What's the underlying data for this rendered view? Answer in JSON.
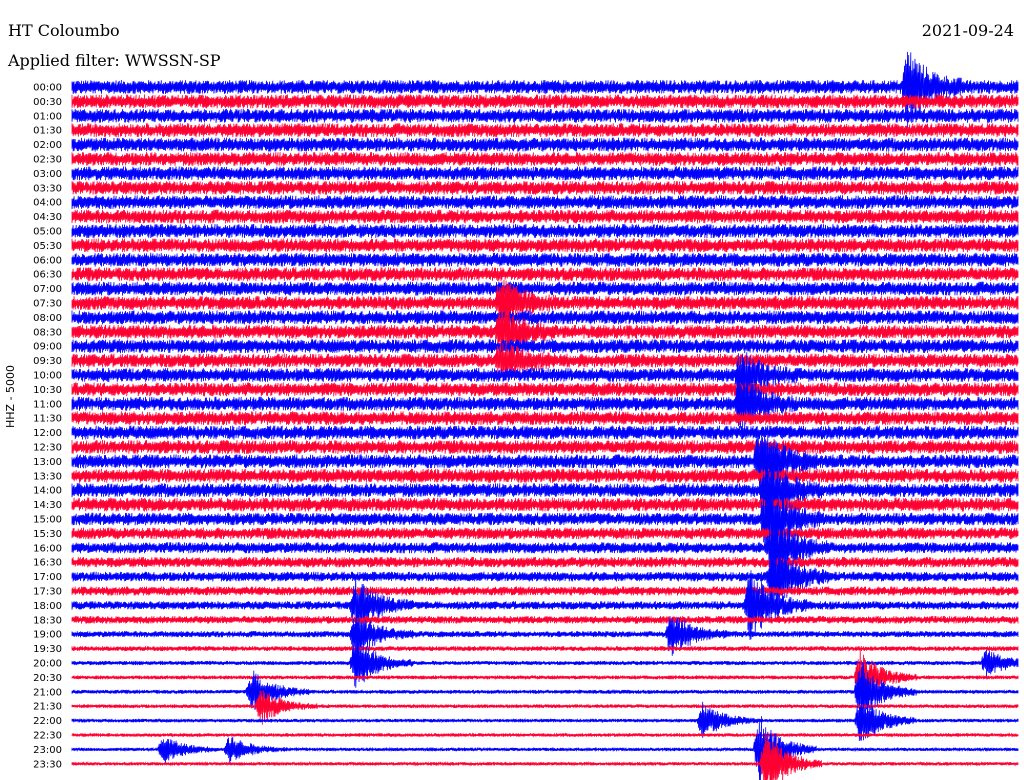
{
  "header": {
    "station": "HT Coloumbo",
    "date": "2021-09-24",
    "filter": "Applied filter: WWSSN-SP"
  },
  "channel_label": "HHZ - 5000",
  "colors": {
    "trace_a": "#0000ff",
    "trace_b": "#ff0033",
    "background": "#ffffff"
  },
  "chart_data": {
    "type": "line",
    "title": "HT Coloumbo",
    "subtitle": "Applied filter: WWSSN-SP",
    "ylabel": "HHZ - 5000",
    "xlabel": "",
    "row_labels": [
      "00:00",
      "00:30",
      "01:00",
      "01:30",
      "02:00",
      "02:30",
      "03:00",
      "03:30",
      "04:00",
      "04:30",
      "05:00",
      "05:30",
      "06:00",
      "06:30",
      "07:00",
      "07:30",
      "08:00",
      "08:30",
      "09:00",
      "09:30",
      "10:00",
      "10:30",
      "11:00",
      "11:30",
      "12:00",
      "12:30",
      "13:00",
      "13:30",
      "14:00",
      "14:30",
      "15:00",
      "15:30",
      "16:00",
      "16:30",
      "17:00",
      "17:30",
      "18:00",
      "18:30",
      "19:00",
      "19:30",
      "20:00",
      "20:30",
      "21:00",
      "21:30",
      "22:00",
      "22:30",
      "23:00",
      "23:30"
    ],
    "x_range_minutes": [
      0,
      30
    ],
    "series_colors": [
      "#0000ff",
      "#ff0033"
    ],
    "noise_level_by_row": [
      1.0,
      1.0,
      1.0,
      1.0,
      1.0,
      1.0,
      1.0,
      1.0,
      1.0,
      1.0,
      1.0,
      1.0,
      1.0,
      1.0,
      1.0,
      1.0,
      1.0,
      1.0,
      1.0,
      1.0,
      1.0,
      1.0,
      1.0,
      1.0,
      1.0,
      1.0,
      1.0,
      1.0,
      1.0,
      1.0,
      0.9,
      0.85,
      0.8,
      0.75,
      0.7,
      0.65,
      0.6,
      0.55,
      0.45,
      0.35,
      0.3,
      0.28,
      0.28,
      0.26,
      0.25,
      0.25,
      0.24,
      0.24
    ],
    "events": [
      {
        "row": 0,
        "minute": 26.5,
        "amplitude": 4.0
      },
      {
        "row": 15,
        "minute": 13.6,
        "amplitude": 2.5
      },
      {
        "row": 17,
        "minute": 13.6,
        "amplitude": 2.5
      },
      {
        "row": 19,
        "minute": 13.6,
        "amplitude": 2.0
      },
      {
        "row": 20,
        "minute": 21.2,
        "amplitude": 2.5
      },
      {
        "row": 22,
        "minute": 21.2,
        "amplitude": 3.0
      },
      {
        "row": 26,
        "minute": 21.8,
        "amplitude": 4.0
      },
      {
        "row": 28,
        "minute": 22.0,
        "amplitude": 3.5
      },
      {
        "row": 30,
        "minute": 22.0,
        "amplitude": 4.0
      },
      {
        "row": 32,
        "minute": 22.2,
        "amplitude": 4.0
      },
      {
        "row": 34,
        "minute": 22.2,
        "amplitude": 4.0
      },
      {
        "row": 36,
        "minute": 21.5,
        "amplitude": 4.0
      },
      {
        "row": 38,
        "minute": 19.0,
        "amplitude": 2.5
      },
      {
        "row": 36,
        "minute": 9.0,
        "amplitude": 3.0
      },
      {
        "row": 38,
        "minute": 9.0,
        "amplitude": 2.5
      },
      {
        "row": 40,
        "minute": 9.0,
        "amplitude": 3.0
      },
      {
        "row": 41,
        "minute": 25.0,
        "amplitude": 3.0
      },
      {
        "row": 42,
        "minute": 5.7,
        "amplitude": 2.5
      },
      {
        "row": 42,
        "minute": 25.0,
        "amplitude": 3.5
      },
      {
        "row": 43,
        "minute": 6.0,
        "amplitude": 2.0
      },
      {
        "row": 44,
        "minute": 20.0,
        "amplitude": 2.0
      },
      {
        "row": 44,
        "minute": 25.0,
        "amplitude": 3.0
      },
      {
        "row": 46,
        "minute": 2.9,
        "amplitude": 1.5
      },
      {
        "row": 46,
        "minute": 5.0,
        "amplitude": 1.5
      },
      {
        "row": 46,
        "minute": 21.8,
        "amplitude": 4.0
      },
      {
        "row": 47,
        "minute": 22.0,
        "amplitude": 4.0
      },
      {
        "row": 40,
        "minute": 29.0,
        "amplitude": 1.5
      }
    ]
  }
}
